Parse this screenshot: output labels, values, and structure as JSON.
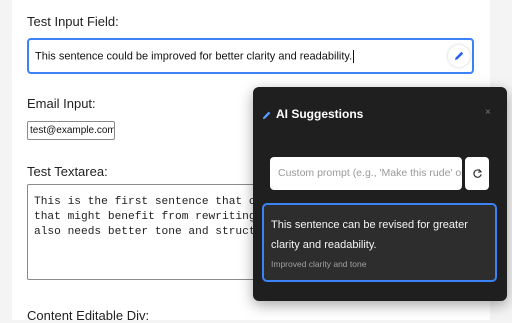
{
  "form": {
    "test_input_label": "Test Input Field:",
    "test_input_value": "This sentence could be improved for better clarity and readability.",
    "email_label": "Email Input:",
    "email_value": "test@example.com",
    "textarea_label": "Test Textarea:",
    "textarea_value": "This is the first sentence that could use s\nthat might benefit from rewriting for clari\nalso needs better tone and structure.",
    "content_editable_label": "Content Editable Div:"
  },
  "ai_panel": {
    "title": "AI Suggestions",
    "close_label": "×",
    "prompt_placeholder": "Custom prompt (e.g., 'Make this rude' or leave e",
    "suggestions": [
      {
        "text": "This sentence can be revised for greater clarity and readability.",
        "note": "Improved clarity and tone"
      }
    ]
  },
  "colors": {
    "accent": "#3b82f6",
    "panel_bg": "#1f1f1f",
    "card_bg": "#2d2d2d"
  },
  "icons": {
    "pencil": "pencil-icon",
    "refresh": "refresh-icon",
    "close": "close-icon"
  }
}
